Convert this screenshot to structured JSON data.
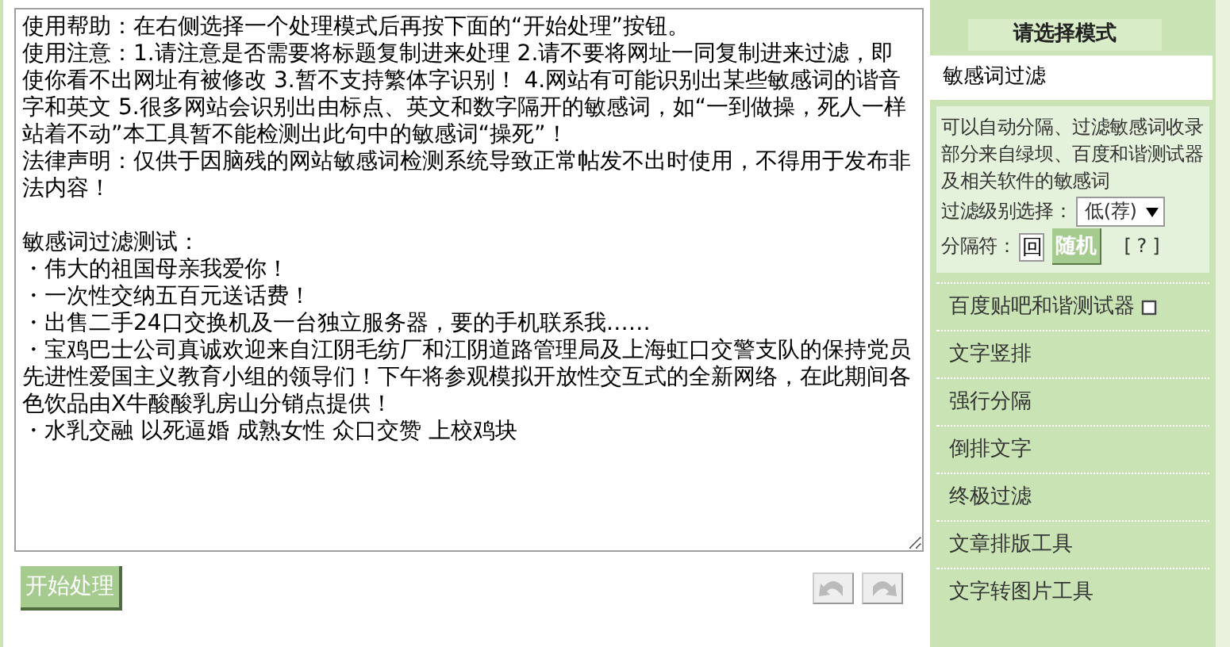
{
  "editor": {
    "value": [
      [
        "使用帮助：在右侧选择一个处理模式后再按下面的“开始处理”按钮。",
        "使用注意：1.请注意是否需要将标题复制进来处理 2.请不要将网址一同复制进来过滤，即使你看不出网址有被修改 3.暂不支持繁体字识别！ 4.网站有可能识别出某些敏感词的谐音字和英文 5.很多网站会识别出由标点、英文和数字隔开的敏感词，如“一到做操，死人一样站着不动”本工具暂不能检测出此句中的敏感词“操死”！",
        "法律声明：仅供于因脑残的网站敏感词检测系统导致正常帖发不出时使用，不得用于发布非法内容！"
      ],
      [
        "敏感词过滤测试：",
        "・伟大的祖国母亲我爱你！",
        "・一次性交纳五百元送话费！",
        "・出售二手24口交换机及一台独立服务器，要的手机联系我……",
        "・宝鸡巴士公司真诚欢迎来自江阴毛纺厂和江阴道路管理局及上海虹口交警支队的保持党员先进性爱国主义教育小组的领导们！下午将参观模拟开放性交互式的全新网络，在此期间各色饮品由X牛酸酸乳房山分销点提供！",
        "・水乳交融 以死逼婚 成熟女性 众口交赞 上校鸡块"
      ]
    ]
  },
  "start_button": "开始处理",
  "sidebar": {
    "heading": "请选择模式",
    "modes": [
      {
        "label": "敏感词过滤",
        "selected": true,
        "external": false
      },
      {
        "label": "百度贴吧和谐测试器",
        "selected": false,
        "external": true
      },
      {
        "label": "文字竖排",
        "selected": false,
        "external": false
      },
      {
        "label": "强行分隔",
        "selected": false,
        "external": false
      },
      {
        "label": "倒排文字",
        "selected": false,
        "external": false
      },
      {
        "label": "终极过滤",
        "selected": false,
        "external": false
      },
      {
        "label": "文章排版工具",
        "selected": false,
        "external": false
      },
      {
        "label": "文字转图片工具",
        "selected": false,
        "external": false
      }
    ],
    "options": {
      "description": "可以自动分隔、过滤敏感词收录部分来自绿坝、百度和谐测试器及相关软件的敏感词",
      "level_label": "过滤级别选择：",
      "level_value": "低(荐)",
      "separator_label": "分隔符：",
      "separator_value": "回",
      "random_button": "随机",
      "help_link": "[ ? ]"
    }
  }
}
